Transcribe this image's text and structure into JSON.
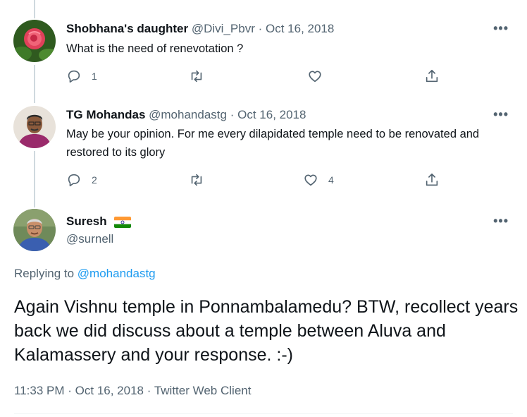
{
  "tweets": [
    {
      "name": "Shobhana's daughter",
      "handle": "@Divi_Pbvr",
      "separator": "·",
      "date": "Oct 16, 2018",
      "text": "What is the need of renevotation ?",
      "more": "•••",
      "actions": {
        "reply": "1",
        "retweet": "",
        "like": ""
      }
    },
    {
      "name": "TG Mohandas",
      "handle": "@mohandastg",
      "separator": "·",
      "date": "Oct 16, 2018",
      "text": "May be your opinion. For me every dilapidated temple need to be renovated and restored to its glory",
      "more": "•••",
      "actions": {
        "reply": "2",
        "retweet": "",
        "like": "4"
      }
    }
  ],
  "main_tweet": {
    "name": "Suresh",
    "handle": "@surnell",
    "more": "•••",
    "flag_icon": "india-flag-icon",
    "replying_label": "Replying to",
    "replying_to": "@mohandastg",
    "text": "Again Vishnu temple in Ponnambalamedu? BTW, recollect years back we did discuss about a temple between Aluva and Kalamassery and your response. :-)",
    "time": "11:33 PM",
    "separator": "·",
    "date": "Oct 16, 2018",
    "client": "Twitter Web Client"
  },
  "colors": {
    "link": "#1d9bf0",
    "muted": "#536471",
    "text": "#0f1419",
    "thread_line": "#cfd9de"
  }
}
